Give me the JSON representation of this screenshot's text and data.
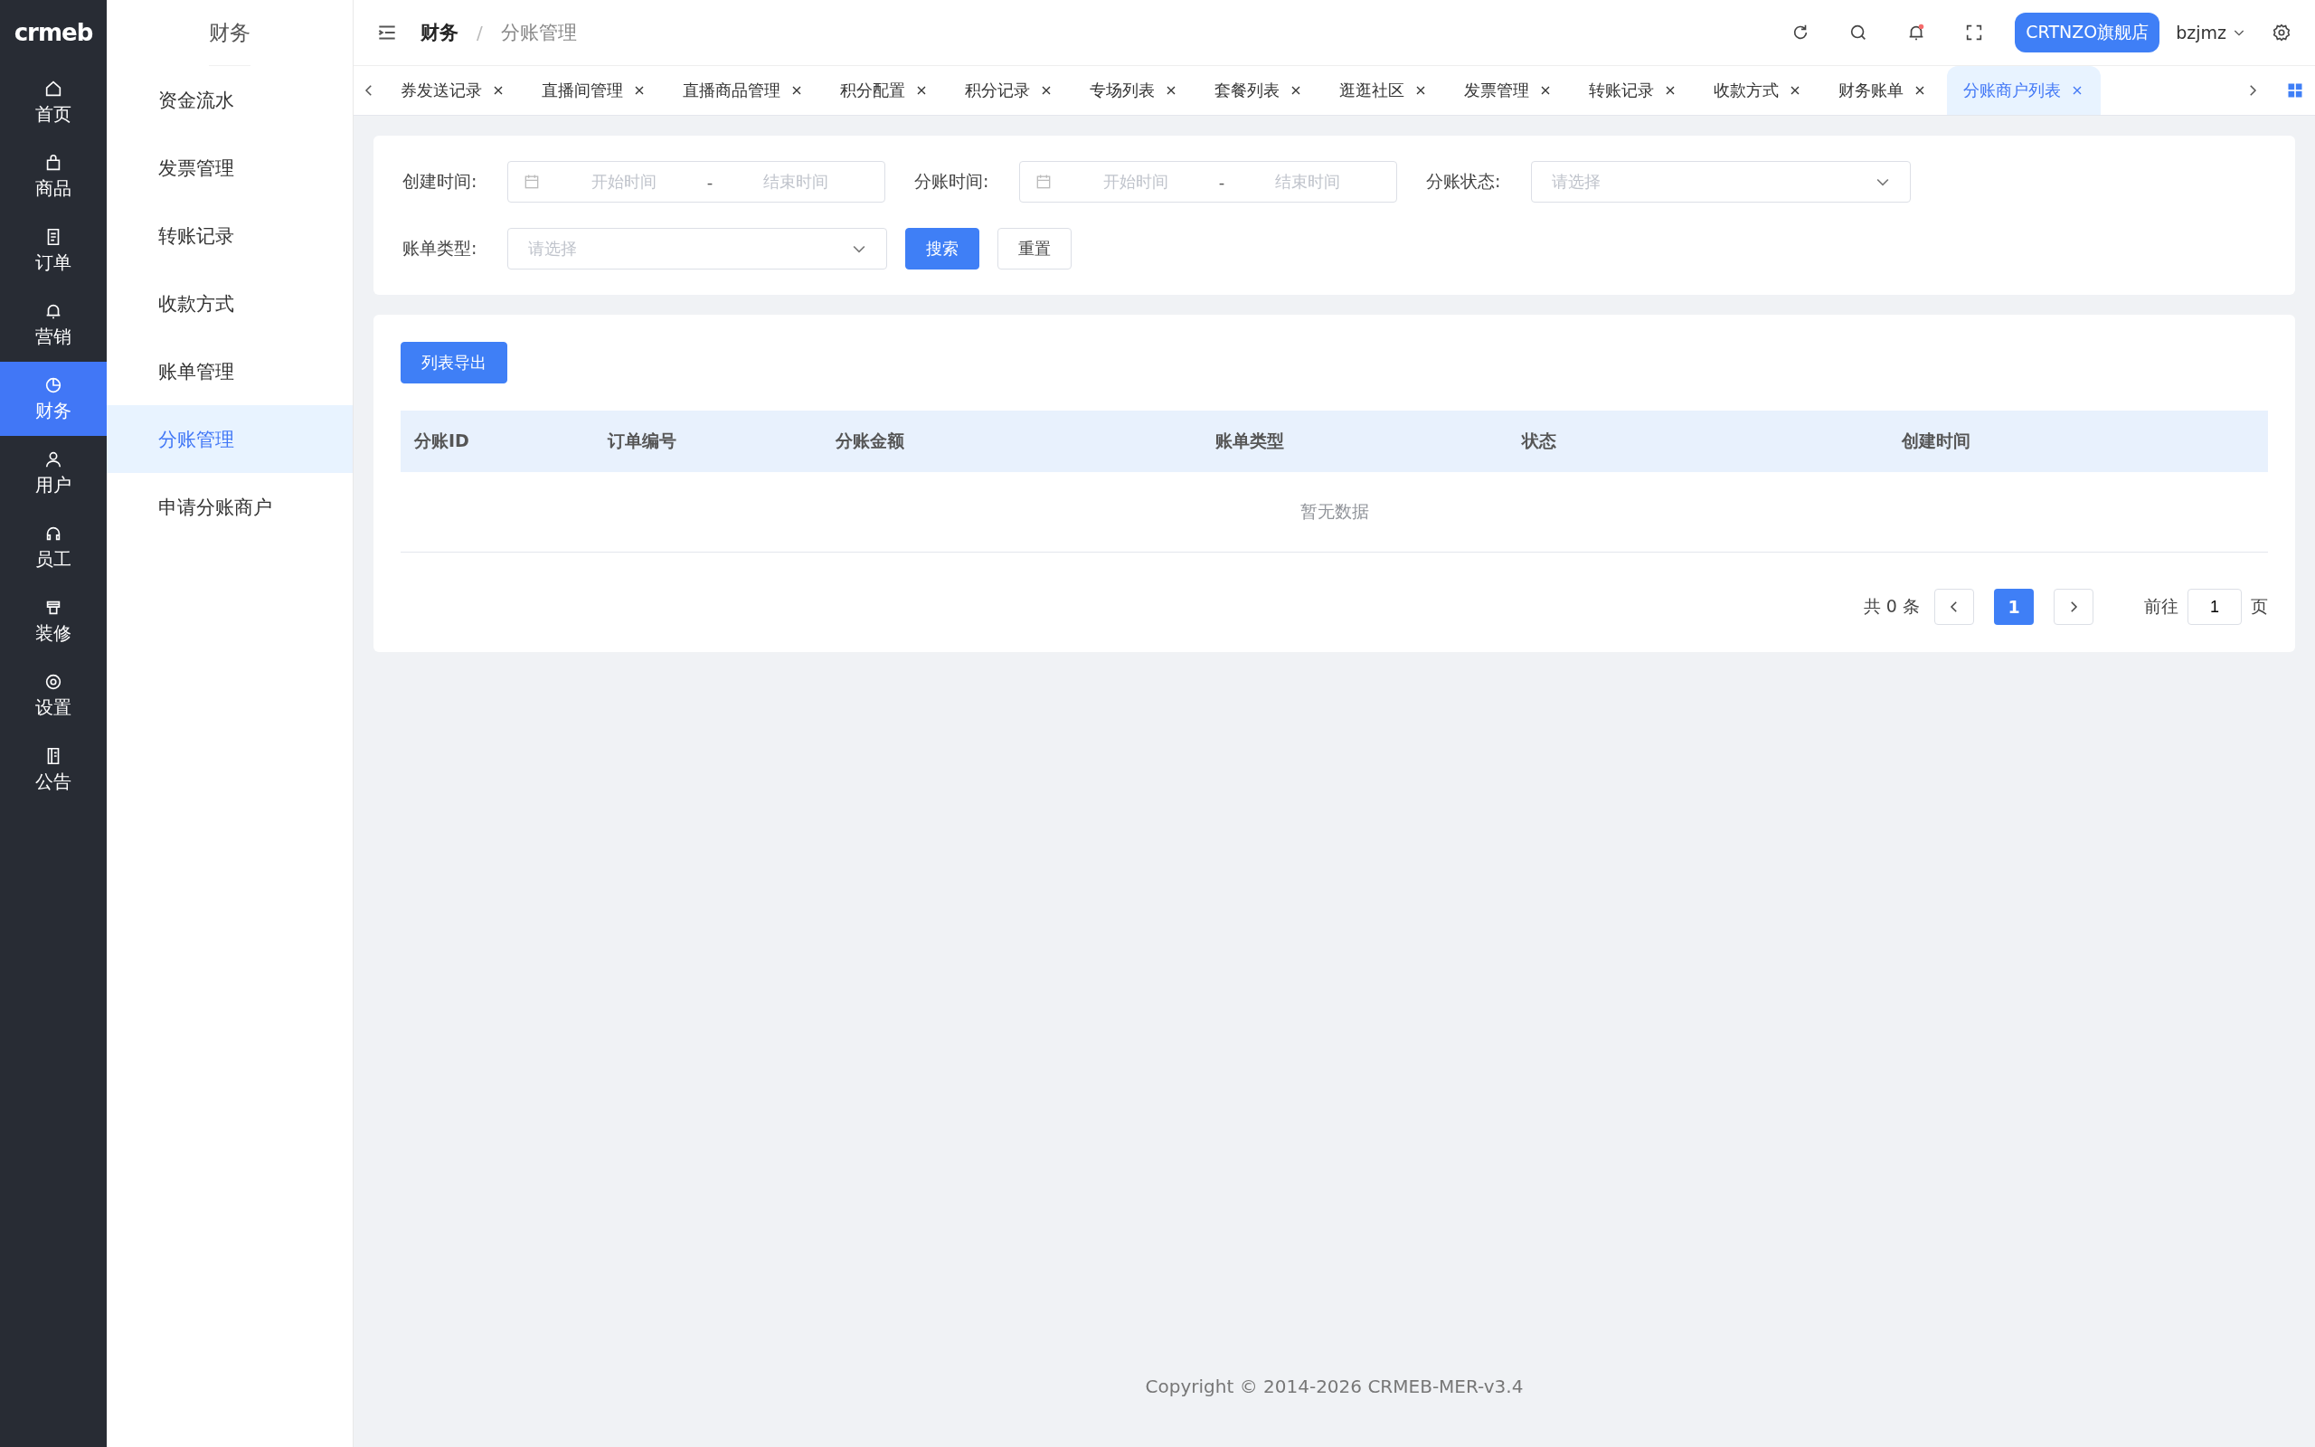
{
  "logo": "crmeb",
  "nav": [
    {
      "label": "首页",
      "selected": false
    },
    {
      "label": "商品",
      "selected": false
    },
    {
      "label": "订单",
      "selected": false
    },
    {
      "label": "营销",
      "selected": false
    },
    {
      "label": "财务",
      "selected": true
    },
    {
      "label": "用户",
      "selected": false
    },
    {
      "label": "员工",
      "selected": false
    },
    {
      "label": "装修",
      "selected": false
    },
    {
      "label": "设置",
      "selected": false
    },
    {
      "label": "公告",
      "selected": false
    }
  ],
  "submenu": {
    "title": "财务",
    "items": [
      {
        "label": "资金流水",
        "selected": false
      },
      {
        "label": "发票管理",
        "selected": false
      },
      {
        "label": "转账记录",
        "selected": false
      },
      {
        "label": "收款方式",
        "selected": false
      },
      {
        "label": "账单管理",
        "selected": false
      },
      {
        "label": "分账管理",
        "selected": true
      },
      {
        "label": "申请分账商户",
        "selected": false
      }
    ]
  },
  "breadcrumb": {
    "separator": "/",
    "items": [
      "财务",
      "分账管理"
    ]
  },
  "header": {
    "notification_dot": true,
    "store_button": "CRTNZO旗舰店",
    "user": "bzjmz"
  },
  "tabs": [
    {
      "label": "券发送记录",
      "selected": false
    },
    {
      "label": "直播间管理",
      "selected": false
    },
    {
      "label": "直播商品管理",
      "selected": false
    },
    {
      "label": "积分配置",
      "selected": false
    },
    {
      "label": "积分记录",
      "selected": false
    },
    {
      "label": "专场列表",
      "selected": false
    },
    {
      "label": "套餐列表",
      "selected": false
    },
    {
      "label": "逛逛社区",
      "selected": false
    },
    {
      "label": "发票管理",
      "selected": false
    },
    {
      "label": "转账记录",
      "selected": false
    },
    {
      "label": "收款方式",
      "selected": false
    },
    {
      "label": "财务账单",
      "selected": false
    },
    {
      "label": "分账商户列表",
      "selected": true
    }
  ],
  "filters": {
    "created_time": {
      "label": "创建时间:",
      "start_placeholder": "开始时间",
      "separator": "-",
      "end_placeholder": "结束时间"
    },
    "split_time": {
      "label": "分账时间:",
      "start_placeholder": "开始时间",
      "separator": "-",
      "end_placeholder": "结束时间"
    },
    "split_status": {
      "label": "分账状态:",
      "placeholder": "请选择"
    },
    "bill_type": {
      "label": "账单类型:",
      "placeholder": "请选择"
    },
    "search_button": "搜索",
    "reset_button": "重置"
  },
  "export_button": "列表导出",
  "table": {
    "columns": [
      "分账ID",
      "订单编号",
      "分账金额",
      "账单类型",
      "状态",
      "创建时间"
    ],
    "empty_text": "暂无数据"
  },
  "pagination": {
    "total": "共 0 条",
    "pages": [
      {
        "label": "1",
        "selected": true
      }
    ],
    "goto_label": "前往",
    "goto_value": "1",
    "page_suffix": "页"
  },
  "footer": "Copyright © 2014-2026 CRMEB-MER-v3.4"
}
